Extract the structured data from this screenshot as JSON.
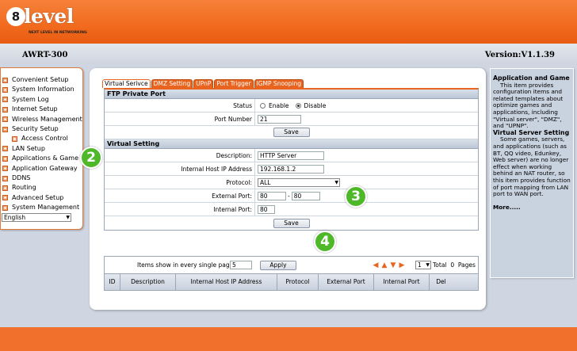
{
  "brand": {
    "logo_digit": "8",
    "logo_text": "level",
    "tagline": "NEXT LEVEL IN NETWORKING"
  },
  "header": {
    "model": "AWRT-300",
    "version": "Version:V1.1.39"
  },
  "sidebar": {
    "items": [
      {
        "label": "Convenient Setup",
        "icon": "plus-box-icon"
      },
      {
        "label": "System Information",
        "icon": "plus-box-icon"
      },
      {
        "label": "System Log",
        "icon": "plus-box-icon"
      },
      {
        "label": "Internet Setup",
        "icon": "plus-box-icon"
      },
      {
        "label": "Wireless Management",
        "icon": "plus-box-icon"
      },
      {
        "label": "Security Setup",
        "icon": "minus-box-icon"
      },
      {
        "label": "Access Control",
        "icon": "plus-box-icon"
      },
      {
        "label": "LAN Setup",
        "icon": "plus-box-icon"
      },
      {
        "label": "Appilcations & Game",
        "icon": "plus-box-icon"
      },
      {
        "label": "Application Gateway",
        "icon": "plus-box-icon"
      },
      {
        "label": "DDNS",
        "icon": "plus-box-icon"
      },
      {
        "label": "Routing",
        "icon": "plus-box-icon"
      },
      {
        "label": "Advanced Setup",
        "icon": "plus-box-icon"
      },
      {
        "label": "System Management",
        "icon": "plus-box-icon"
      }
    ],
    "language": "English"
  },
  "tabs": [
    "Virtual Serivce",
    "DMZ Setting",
    "UPnP",
    "Port Trigger",
    "IGMP Snooping"
  ],
  "ftp": {
    "title": "FTP Private Port",
    "status_label": "Status",
    "enable_label": "Enable",
    "disable_label": "Disable",
    "status_value": "Disable",
    "port_label": "Port Number",
    "port_value": "21",
    "save_label": "Save"
  },
  "virtual": {
    "title": "Virtual Setting",
    "desc_label": "Description:",
    "desc_value": "HTTP Server",
    "ip_label": "Internal Host IP Address",
    "ip_value": "192.168.1.2",
    "proto_label": "Protocol:",
    "proto_value": "ALL",
    "ext_label": "External Port:",
    "ext_from": "80",
    "ext_sep": "-",
    "ext_to": "80",
    "int_label": "Internal Port:",
    "int_value": "80",
    "save_label": "Save"
  },
  "list": {
    "page_size_label": "Items show in every single page",
    "page_size_value": "5",
    "apply_label": "Apply",
    "page_value": "1",
    "total_label": "Total",
    "total_count": "0",
    "pages_label": "Pages",
    "columns": [
      "ID",
      "Description",
      "Internal Host IP Address",
      "Protocol",
      "External Port",
      "Internal Port",
      "Del"
    ]
  },
  "info": {
    "title1": "Application and Game",
    "text1": "This item provides configuration items and related templates about optimize games and applications, including \"Virtual server\", \"DMZ\", and \"UPNP\".",
    "title2": "Virtual Server Setting",
    "text2": "Some games, servers, and applications (such as BT, QQ video, Edunkey, Web server) are no longer effect when working behind an NAT router, so this item provides function of port mapping from LAN port to WAN port.",
    "more": "More....."
  },
  "callouts": [
    "2",
    "3",
    "4"
  ],
  "colors": {
    "accent": "#f16a1d",
    "callout": "#4eb829",
    "panel_bg": "#cfd6e2"
  }
}
